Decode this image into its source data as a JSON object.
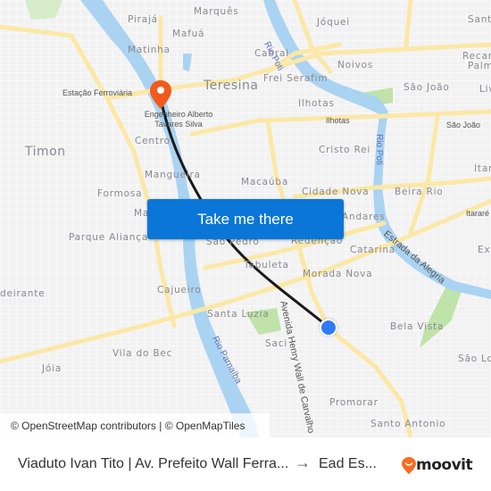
{
  "map": {
    "labels": {
      "pirajá": "Pirajá",
      "marques": "Marquês",
      "matinha": "Matinha",
      "mafua": "Mafuá",
      "cabral": "Cabral",
      "joquei": "Jóquei",
      "santa": "Santa",
      "recanto": "Recan",
      "palm": "Palm",
      "noivos": "Noivos",
      "frei_serafim": "Frei Serafim",
      "teresina": "Teresina",
      "estacao": "Estação Ferroviária",
      "ilhotas": "Ilhotas",
      "ilhotas_road": "Ilhotas",
      "sao_joao": "São João",
      "sao_joao_road": "São João",
      "liv": "Liv",
      "timon": "Timon",
      "centro": "Centro",
      "cristo_rei": "Cristo Rei",
      "ita": "Itar",
      "mangueira": "Mangueira",
      "macauba": "Macaúba",
      "formosa": "Formosa",
      "cidade_nova": "Cidade Nova",
      "beira_rio": "Beira Rio",
      "itarare": "Itararé",
      "ma": "Ma",
      "andares": "Andares",
      "parque_alianca": "Parque Aliança",
      "sao_pedro": "São Pedro",
      "redencao": "Redenção",
      "catarina": "Catarina",
      "ext": "Ext",
      "tabuleta": "Tabuleta",
      "morada_nova": "Morada Nova",
      "bandeirante": "deirante",
      "cajueiro": "Cajueiro",
      "santa_luzia": "Santa Luzia",
      "bela_vista": "Bela Vista",
      "saci": "Saci",
      "vila_do_bec": "Vila do Bec",
      "joia": "Jóia",
      "sao_lo": "São Lo",
      "promorar": "Promorar",
      "santo_antonio": "Santo Antonio",
      "rio_poti_1": "Rio Poti",
      "rio_poti_2": "Rio Poti",
      "rio_parnaiba": "Rio Parnaíba",
      "estrada_alegria": "Estrada da Alegria",
      "av_henry": "Avenida Henry Wall de Carvalho"
    },
    "destination_label": "Engenheiro Alberto Tavares Silva",
    "cta_label": "Take me there",
    "attribution": "© OpenStreetMap contributors | © OpenMapTiles",
    "colors": {
      "cta": "#0a76d8",
      "destination_pin": "#f25a1d",
      "origin_dot": "#2f7cf6",
      "route": "#1a1a1a",
      "water": "#aad3f2",
      "road_major": "#fbe8a6",
      "park": "#bfe3a8"
    }
  },
  "footer": {
    "from": "Viaduto Ivan Tito | Av. Prefeito Wall Ferra...",
    "arrow": "→",
    "to": "Ead Es...",
    "brand": "moovit",
    "brand_color": "#f96b1e"
  }
}
